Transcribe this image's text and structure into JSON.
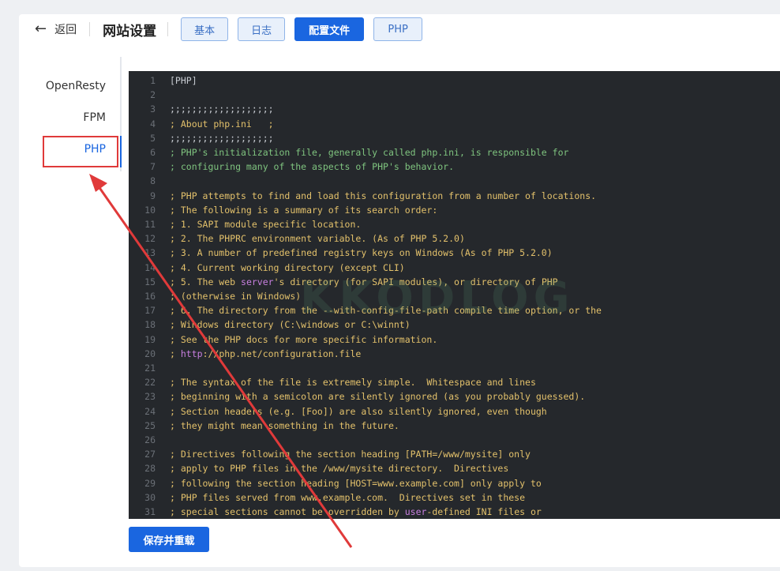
{
  "header": {
    "back_label": "返回",
    "title": "网站设置",
    "tabs": [
      {
        "label": "基本",
        "active": false
      },
      {
        "label": "日志",
        "active": false
      },
      {
        "label": "配置文件",
        "active": true
      },
      {
        "label": "PHP",
        "active": false
      }
    ]
  },
  "sidebar": {
    "items": [
      {
        "label": "OpenResty"
      },
      {
        "label": "FPM"
      },
      {
        "label": "PHP",
        "active": true
      }
    ]
  },
  "editor": {
    "lines": [
      {
        "n": "1",
        "t": "[PHP]",
        "style": "plain"
      },
      {
        "n": "2",
        "t": "",
        "style": "plain"
      },
      {
        "n": "3",
        "t": ";;;;;;;;;;;;;;;;;;;",
        "style": "plain"
      },
      {
        "n": "4",
        "t": "; About php.ini   ;",
        "style": "yellow"
      },
      {
        "n": "5",
        "t": ";;;;;;;;;;;;;;;;;;;",
        "style": "plain"
      },
      {
        "n": "6",
        "t": "; PHP's initialization file, generally called php.ini, is responsible for",
        "style": "green"
      },
      {
        "n": "7",
        "t": "; configuring many of the aspects of PHP's behavior.",
        "style": "green"
      },
      {
        "n": "8",
        "t": "",
        "style": "plain"
      },
      {
        "n": "9",
        "t": "; PHP attempts to find and load this configuration from a number of locations.",
        "style": "yellow"
      },
      {
        "n": "10",
        "t": "; The following is a summary of its search order:",
        "style": "yellow"
      },
      {
        "n": "11",
        "t": "; 1. SAPI module specific location.",
        "style": "yellow"
      },
      {
        "n": "12",
        "t": "; 2. The PHPRC environment variable. (As of PHP 5.2.0)",
        "style": "yellow"
      },
      {
        "n": "13",
        "t": "; 3. A number of predefined registry keys on Windows (As of PHP 5.2.0)",
        "style": "yellow"
      },
      {
        "n": "14",
        "t": "; 4. Current working directory (except CLI)",
        "style": "yellow"
      },
      {
        "n": "15",
        "t": "; 5. The web server's directory (for SAPI modules), or directory of PHP",
        "style": "yellow",
        "purple_word": "server"
      },
      {
        "n": "16",
        "t": "; (otherwise in Windows)",
        "style": "yellow"
      },
      {
        "n": "17",
        "t": "; 6. The directory from the --with-config-file-path compile time option, or the",
        "style": "yellow"
      },
      {
        "n": "18",
        "t": "; Windows directory (C:\\windows or C:\\winnt)",
        "style": "yellow"
      },
      {
        "n": "19",
        "t": "; See the PHP docs for more specific information.",
        "style": "yellow"
      },
      {
        "n": "20",
        "t": "; http://php.net/configuration.file",
        "style": "yellow",
        "purple_word": "http"
      },
      {
        "n": "21",
        "t": "",
        "style": "plain"
      },
      {
        "n": "22",
        "t": "; The syntax of the file is extremely simple.  Whitespace and lines",
        "style": "yellow"
      },
      {
        "n": "23",
        "t": "; beginning with a semicolon are silently ignored (as you probably guessed).",
        "style": "yellow"
      },
      {
        "n": "24",
        "t": "; Section headers (e.g. [Foo]) are also silently ignored, even though",
        "style": "yellow"
      },
      {
        "n": "25",
        "t": "; they might mean something in the future.",
        "style": "yellow"
      },
      {
        "n": "26",
        "t": "",
        "style": "plain"
      },
      {
        "n": "27",
        "t": "; Directives following the section heading [PATH=/www/mysite] only",
        "style": "yellow"
      },
      {
        "n": "28",
        "t": "; apply to PHP files in the /www/mysite directory.  Directives",
        "style": "yellow"
      },
      {
        "n": "29",
        "t": "; following the section heading [HOST=www.example.com] only apply to",
        "style": "yellow"
      },
      {
        "n": "30",
        "t": "; PHP files served from www.example.com.  Directives set in these",
        "style": "yellow"
      },
      {
        "n": "31",
        "t": "; special sections cannot be overridden by user-defined INI files or",
        "style": "yellow",
        "purple_word": "user"
      }
    ]
  },
  "footer": {
    "save_label": "保存并重载"
  },
  "colors": {
    "accent": "#1a66e0",
    "editor_bg": "#25282c",
    "comment_yellow": "#e3c16b",
    "comment_green": "#7fc47f",
    "keyword_purple": "#c87fe0",
    "annotation_red": "#e03a3a"
  }
}
